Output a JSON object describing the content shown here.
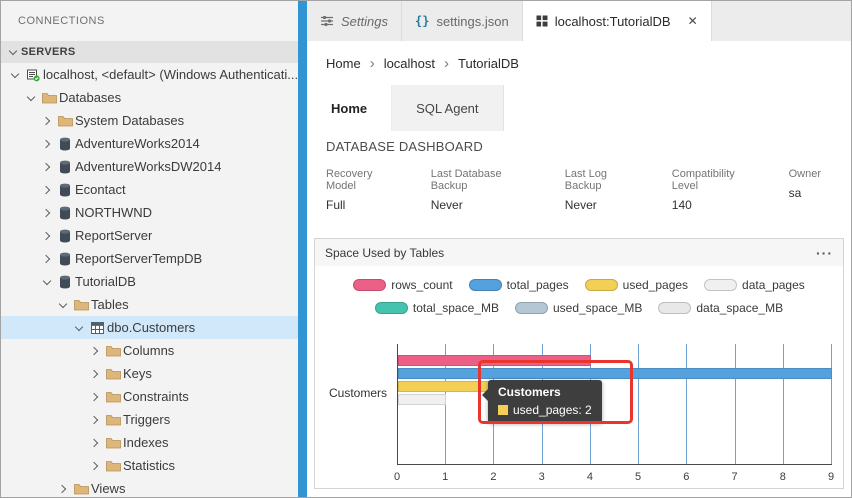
{
  "colors": {
    "accent_bar": "#3095d2",
    "annotation": "#e8352e",
    "selected_row": "#d1e8fb"
  },
  "sidebar": {
    "title": "CONNECTIONS",
    "servers_header": "SERVERS",
    "tree": [
      {
        "label": "localhost, <default> (Windows Authenticati...",
        "level": 0,
        "chevron": "down",
        "icon": "server"
      },
      {
        "label": "Databases",
        "level": 1,
        "chevron": "down",
        "icon": "folder"
      },
      {
        "label": "System Databases",
        "level": 2,
        "chevron": "right",
        "icon": "folder"
      },
      {
        "label": "AdventureWorks2014",
        "level": 2,
        "chevron": "right",
        "icon": "database"
      },
      {
        "label": "AdventureWorksDW2014",
        "level": 2,
        "chevron": "right",
        "icon": "database"
      },
      {
        "label": "Econtact",
        "level": 2,
        "chevron": "right",
        "icon": "database"
      },
      {
        "label": "NORTHWND",
        "level": 2,
        "chevron": "right",
        "icon": "database"
      },
      {
        "label": "ReportServer",
        "level": 2,
        "chevron": "right",
        "icon": "database"
      },
      {
        "label": "ReportServerTempDB",
        "level": 2,
        "chevron": "right",
        "icon": "database"
      },
      {
        "label": "TutorialDB",
        "level": 2,
        "chevron": "down",
        "icon": "database"
      },
      {
        "label": "Tables",
        "level": 3,
        "chevron": "down",
        "icon": "folder"
      },
      {
        "label": "dbo.Customers",
        "level": 4,
        "chevron": "down",
        "icon": "table",
        "selected": true
      },
      {
        "label": "Columns",
        "level": 5,
        "chevron": "right",
        "icon": "folder"
      },
      {
        "label": "Keys",
        "level": 5,
        "chevron": "right",
        "icon": "folder"
      },
      {
        "label": "Constraints",
        "level": 5,
        "chevron": "right",
        "icon": "folder"
      },
      {
        "label": "Triggers",
        "level": 5,
        "chevron": "right",
        "icon": "folder"
      },
      {
        "label": "Indexes",
        "level": 5,
        "chevron": "right",
        "icon": "folder"
      },
      {
        "label": "Statistics",
        "level": 5,
        "chevron": "right",
        "icon": "folder"
      },
      {
        "label": "Views",
        "level": 3,
        "chevron": "right",
        "icon": "folder"
      }
    ]
  },
  "editor_tabs": [
    {
      "label": "Settings"
    },
    {
      "label": "settings.json",
      "icon_glyph": "{}"
    },
    {
      "label": "localhost:TutorialDB",
      "active": true,
      "close_glyph": "✕"
    }
  ],
  "breadcrumb": {
    "items": [
      "Home",
      "localhost",
      "TutorialDB"
    ],
    "separator": "›"
  },
  "subtabs": [
    {
      "label": "Home",
      "active": true
    },
    {
      "label": "SQL Agent",
      "active": false
    }
  ],
  "dashboard": {
    "title": "DATABASE DASHBOARD",
    "properties": [
      {
        "label": "Recovery Model",
        "value": "Full"
      },
      {
        "label": "Last Database Backup",
        "value": "Never"
      },
      {
        "label": "Last Log Backup",
        "value": "Never"
      },
      {
        "label": "Compatibility Level",
        "value": "140"
      },
      {
        "label": "Owner",
        "value": "sa"
      }
    ]
  },
  "widget": {
    "title": "Space Used by Tables",
    "menu_label": "···"
  },
  "chart_data": {
    "type": "bar",
    "orientation": "horizontal",
    "title": "Space Used by Tables",
    "categories": [
      "Customers"
    ],
    "series": [
      {
        "name": "rows_count",
        "color": "#ec5f86",
        "values": [
          4
        ]
      },
      {
        "name": "total_pages",
        "color": "#54a1dd",
        "values": [
          9
        ]
      },
      {
        "name": "used_pages",
        "color": "#f3cf55",
        "values": [
          2
        ]
      },
      {
        "name": "data_pages",
        "color": "#f0f0f0",
        "values": [
          1
        ]
      },
      {
        "name": "total_space_MB",
        "color": "#46c3ae",
        "values": [
          0
        ]
      },
      {
        "name": "used_space_MB",
        "color": "#b3c7d5",
        "values": [
          0
        ]
      },
      {
        "name": "data_space_MB",
        "color": "#e8e8e8",
        "values": [
          0
        ]
      }
    ],
    "xlim": [
      0,
      9
    ],
    "xticks": [
      0,
      1,
      2,
      3,
      4,
      5,
      6,
      7,
      8,
      9
    ],
    "grid": true,
    "legend_position": "top",
    "tooltip": {
      "title": "Customers",
      "series": "used_pages",
      "value": 2,
      "label": "used_pages: 2",
      "color": "#f3cf55"
    }
  }
}
